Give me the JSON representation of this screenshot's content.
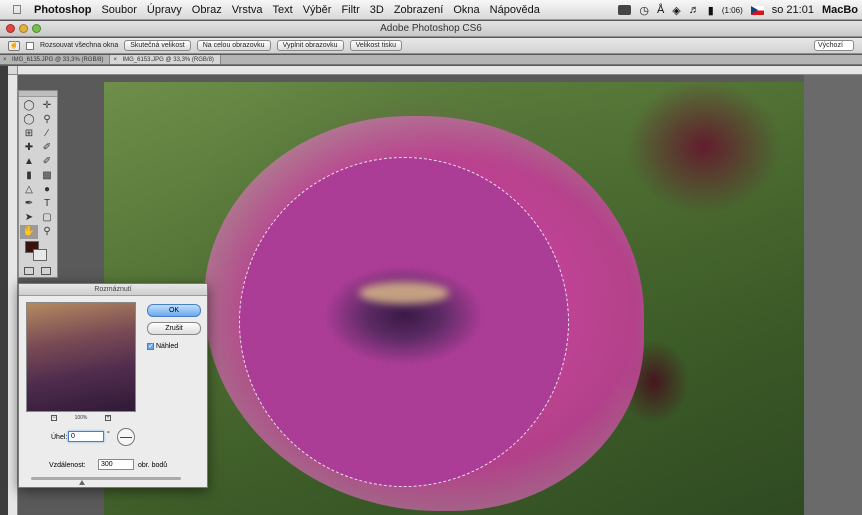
{
  "menubar": {
    "app_name": "Photoshop",
    "items": [
      "Soubor",
      "Úpravy",
      "Obraz",
      "Vrstva",
      "Text",
      "Výběr",
      "Filtr",
      "3D",
      "Zobrazení",
      "Okna",
      "Nápověda"
    ],
    "battery": "(1:06)",
    "clock": "so 21:01",
    "host": "MacBo"
  },
  "window": {
    "title": "Adobe Photoshop CS6"
  },
  "options_bar": {
    "checkbox_label": "Rozsouvat všechna okna",
    "buttons": [
      "Skutečná velikost",
      "Na celou obrazovku",
      "Vyplnit obrazovku",
      "Velikost tisku"
    ],
    "workspace_select": "Výchozí"
  },
  "tabs": [
    "IMG_6135.JPG @ 33,3% (RGB/8)",
    "IMG_6153.JPG @ 33,3% (RGB/8)"
  ],
  "dialog": {
    "title": "Rozmáznutí",
    "ok_label": "OK",
    "cancel_label": "Zrušit",
    "preview_label": "Náhled",
    "preview_checked": true,
    "zoom_level": "100%",
    "angle_label": "Úhel:",
    "angle_value": "0",
    "angle_unit": "°",
    "distance_label": "Vzdálenost:",
    "distance_value": "300",
    "distance_unit": "obr. bodů"
  },
  "colors": {
    "foreground": "#3b1210",
    "background": "#e8e8e8",
    "accent": "#6aa8ea"
  }
}
